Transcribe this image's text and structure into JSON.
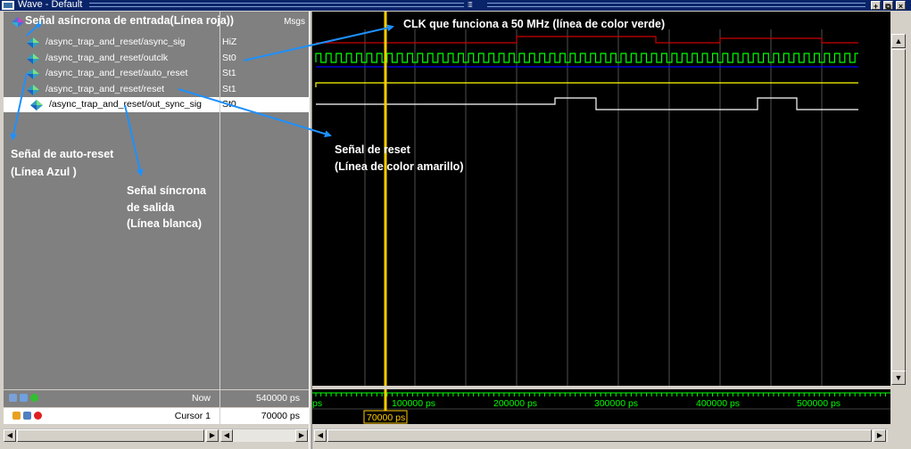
{
  "window": {
    "title": "Wave - Default",
    "buttons": [
      "+",
      "⧉",
      "×"
    ]
  },
  "header": {
    "msgs_label": "Msgs"
  },
  "signals": [
    {
      "name": "/async_trap_and_reset/async_sig",
      "value": "HiZ",
      "selected": false
    },
    {
      "name": "/async_trap_and_reset/outclk",
      "value": "St0",
      "selected": false
    },
    {
      "name": "/async_trap_and_reset/auto_reset",
      "value": "St1",
      "selected": false
    },
    {
      "name": "/async_trap_and_reset/reset",
      "value": "St1",
      "selected": false
    },
    {
      "name": "/async_trap_and_reset/out_sync_sig",
      "value": "St0",
      "selected": true
    }
  ],
  "status": {
    "now_label": "Now",
    "now_value": "540000 ps",
    "cursor_label": "Cursor 1",
    "cursor_value": "70000 ps",
    "cursor_badge": "70000 ps"
  },
  "timeline": {
    "tick_labels": [
      "ps",
      "100000 ps",
      "200000 ps",
      "300000 ps",
      "400000 ps",
      "500000 ps"
    ],
    "axis_color": "#00ff00",
    "cursor_color": "#ffcc00"
  },
  "annotations": {
    "async_note": "Señal asíncrona de entrada(Línea roja))",
    "clk_note": "CLK que funciona a 50 MHz (línea de color verde)",
    "autoreset_note_1": "Señal de auto-reset",
    "autoreset_note_2": "(Línea Azul )",
    "sync_note_1": "Señal síncrona",
    "sync_note_2": "de salida",
    "sync_note_3": "(Línea blanca)",
    "reset_note_1": "Señal de reset",
    "reset_note_2": "(Línea de color amarillo)"
  },
  "colors": {
    "async_sig": "#cc0000",
    "outclk": "#00ff00",
    "auto_reset": "#0000ff",
    "reset": "#ffff00",
    "out_sync_sig": "#ffffff",
    "arrow": "#1e90ff"
  }
}
